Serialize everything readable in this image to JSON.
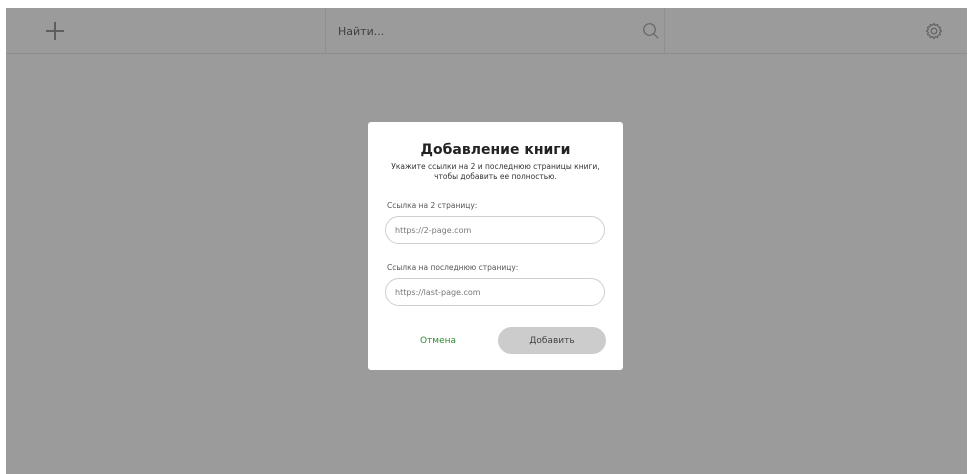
{
  "header": {
    "add_icon": "plus-icon",
    "search": {
      "placeholder": "Найти...",
      "icon": "search-icon"
    },
    "settings_icon": "gear-icon"
  },
  "modal": {
    "title": "Добавление книги",
    "description": "Укажите ссылки на 2 и последнюю страницы книги, чтобы добавить ее полностью.",
    "fields": [
      {
        "label": "Ссылка на 2 страницу:",
        "placeholder": "https://2-page.com",
        "value": ""
      },
      {
        "label": "Ссылка на последнюю страницу:",
        "placeholder": "https://last-page.com",
        "value": ""
      }
    ],
    "cancel_label": "Отмена",
    "submit_label": "Добавить"
  },
  "colors": {
    "overlay": "#9b9b9b",
    "accent_green": "#2f8a2f",
    "button_gray": "#cccccc"
  }
}
